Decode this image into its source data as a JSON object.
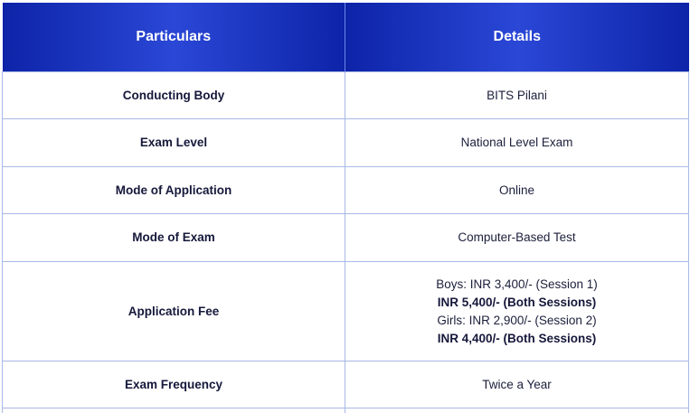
{
  "table": {
    "headers": [
      "Particulars",
      "Details"
    ],
    "rows": [
      {
        "label": "Conducting Body",
        "value": "BITS Pilani"
      },
      {
        "label": "Exam Level",
        "value": "National Level Exam"
      },
      {
        "label": "Mode of Application",
        "value": "Online"
      },
      {
        "label": "Mode of Exam",
        "value": "Computer-Based Test"
      },
      {
        "label": "Application Fee",
        "lines": [
          "Boys: INR 3,400/- (Session 1)",
          "INR 5,400/- (Both Sessions)",
          "Girls: INR 2,900/- (Session 2)",
          "INR 4,400/- (Both Sessions)"
        ]
      },
      {
        "label": "Exam Frequency",
        "value": "Twice a Year"
      }
    ]
  },
  "colors": {
    "header_bg": "#1a33c0",
    "header_text": "#ffffff",
    "border": "#a9b8e6",
    "label_text": "#15183a"
  }
}
